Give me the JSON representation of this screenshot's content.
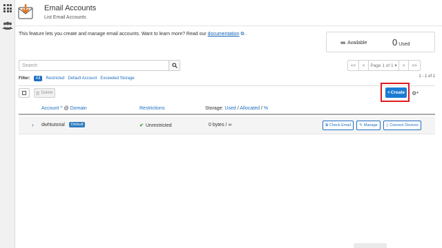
{
  "sidebar": {
    "grid_icon": "grid-icon",
    "users_icon": "users-icon"
  },
  "header": {
    "title": "Email Accounts",
    "subtitle": "List Email Accounts"
  },
  "intro": {
    "text": "This feature lets you create and manage email accounts. Want to learn more? Read our",
    "link": "documentation",
    "suffix": "."
  },
  "stats": {
    "available_symbol": "∞",
    "available_label": "Available",
    "used_count": "0",
    "used_label": "Used"
  },
  "search": {
    "placeholder": "Search"
  },
  "pagination": {
    "first": "<<",
    "prev": "<",
    "page_label": "Page 1 of 1 ▾",
    "next": ">",
    "last": ">>",
    "range": "1 - 1 of 1"
  },
  "filter": {
    "label": "Filter:",
    "options": [
      "All",
      "Restricted",
      "Default Account",
      "Exceeded Storage"
    ]
  },
  "toolbar": {
    "delete_label": "Delete",
    "create_label": "Create",
    "settings_caret": "▾"
  },
  "table": {
    "col_account": "Account",
    "col_at": "@",
    "col_domain": "Domain",
    "col_restrictions": "Restrictions",
    "col_storage_prefix": "Storage:",
    "col_storage_used": "Used",
    "col_storage_allocated": "Allocated",
    "col_storage_percent": "%",
    "rows": [
      {
        "account": "dwhtutorial",
        "badge": "Default",
        "restrictions": "Unrestricted",
        "storage": "0 bytes / ∞",
        "actions": [
          "Check Email",
          "Manage",
          "Connect Devices"
        ]
      }
    ]
  },
  "colors": {
    "accent": "#1b6ec2",
    "create": "#1b7bd3",
    "highlight": "#e0181b",
    "ok": "#3c9a3c"
  }
}
